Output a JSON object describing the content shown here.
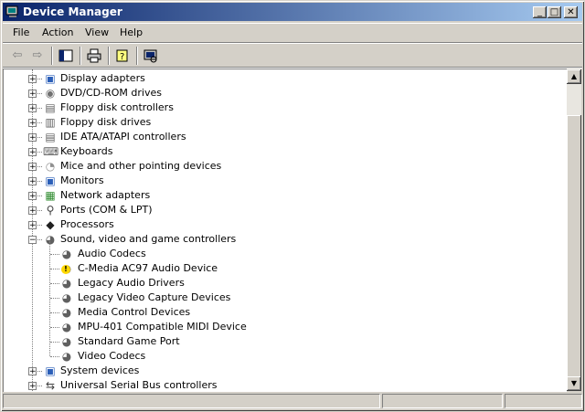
{
  "window": {
    "title": "Device Manager",
    "controls": {
      "minimize": "_",
      "maximize": "□",
      "close": "✕"
    }
  },
  "menu": [
    "File",
    "Action",
    "View",
    "Help"
  ],
  "toolbar": {
    "back_icon": "arrow-left-icon",
    "forward_icon": "arrow-right-icon",
    "buttons": [
      "show-hide-console-tree-icon",
      "print-icon",
      "help-icon",
      "scan-hardware-icon"
    ]
  },
  "tree": {
    "items": [
      {
        "label": "Display adapters",
        "expander": "+",
        "icon": "display-adapter-icon"
      },
      {
        "label": "DVD/CD-ROM drives",
        "expander": "+",
        "icon": "cdrom-icon"
      },
      {
        "label": "Floppy disk controllers",
        "expander": "+",
        "icon": "floppy-controller-icon"
      },
      {
        "label": "Floppy disk drives",
        "expander": "+",
        "icon": "floppy-drive-icon"
      },
      {
        "label": "IDE ATA/ATAPI controllers",
        "expander": "+",
        "icon": "ide-controller-icon"
      },
      {
        "label": "Keyboards",
        "expander": "+",
        "icon": "keyboard-icon"
      },
      {
        "label": "Mice and other pointing devices",
        "expander": "+",
        "icon": "mouse-icon"
      },
      {
        "label": "Monitors",
        "expander": "+",
        "icon": "monitor-icon"
      },
      {
        "label": "Network adapters",
        "expander": "+",
        "icon": "network-adapter-icon"
      },
      {
        "label": "Ports (COM & LPT)",
        "expander": "+",
        "icon": "port-icon"
      },
      {
        "label": "Processors",
        "expander": "+",
        "icon": "processor-icon"
      },
      {
        "label": "Sound, video and game controllers",
        "expander": "−",
        "icon": "sound-icon"
      },
      {
        "label": "Audio Codecs",
        "child": true,
        "icon": "sound-device-icon"
      },
      {
        "label": "C-Media AC97 Audio Device",
        "child": true,
        "icon": "warning-device-icon",
        "warning": true
      },
      {
        "label": "Legacy Audio Drivers",
        "child": true,
        "icon": "sound-device-icon"
      },
      {
        "label": "Legacy Video Capture Devices",
        "child": true,
        "icon": "sound-device-icon"
      },
      {
        "label": "Media Control Devices",
        "child": true,
        "icon": "sound-device-icon"
      },
      {
        "label": "MPU-401 Compatible MIDI Device",
        "child": true,
        "icon": "sound-device-icon"
      },
      {
        "label": "Standard Game Port",
        "child": true,
        "icon": "sound-device-icon"
      },
      {
        "label": "Video Codecs",
        "child": true,
        "icon": "sound-device-icon"
      },
      {
        "label": "System devices",
        "expander": "+",
        "icon": "system-device-icon"
      },
      {
        "label": "Universal Serial Bus controllers",
        "expander": "+",
        "icon": "usb-icon"
      }
    ]
  },
  "scrollbar": {
    "up_icon": "scroll-up-icon",
    "down_icon": "scroll-down-icon"
  },
  "colors": {
    "title_start": "#0a246a",
    "title_end": "#a6caf0",
    "face": "#d4d0c8"
  }
}
